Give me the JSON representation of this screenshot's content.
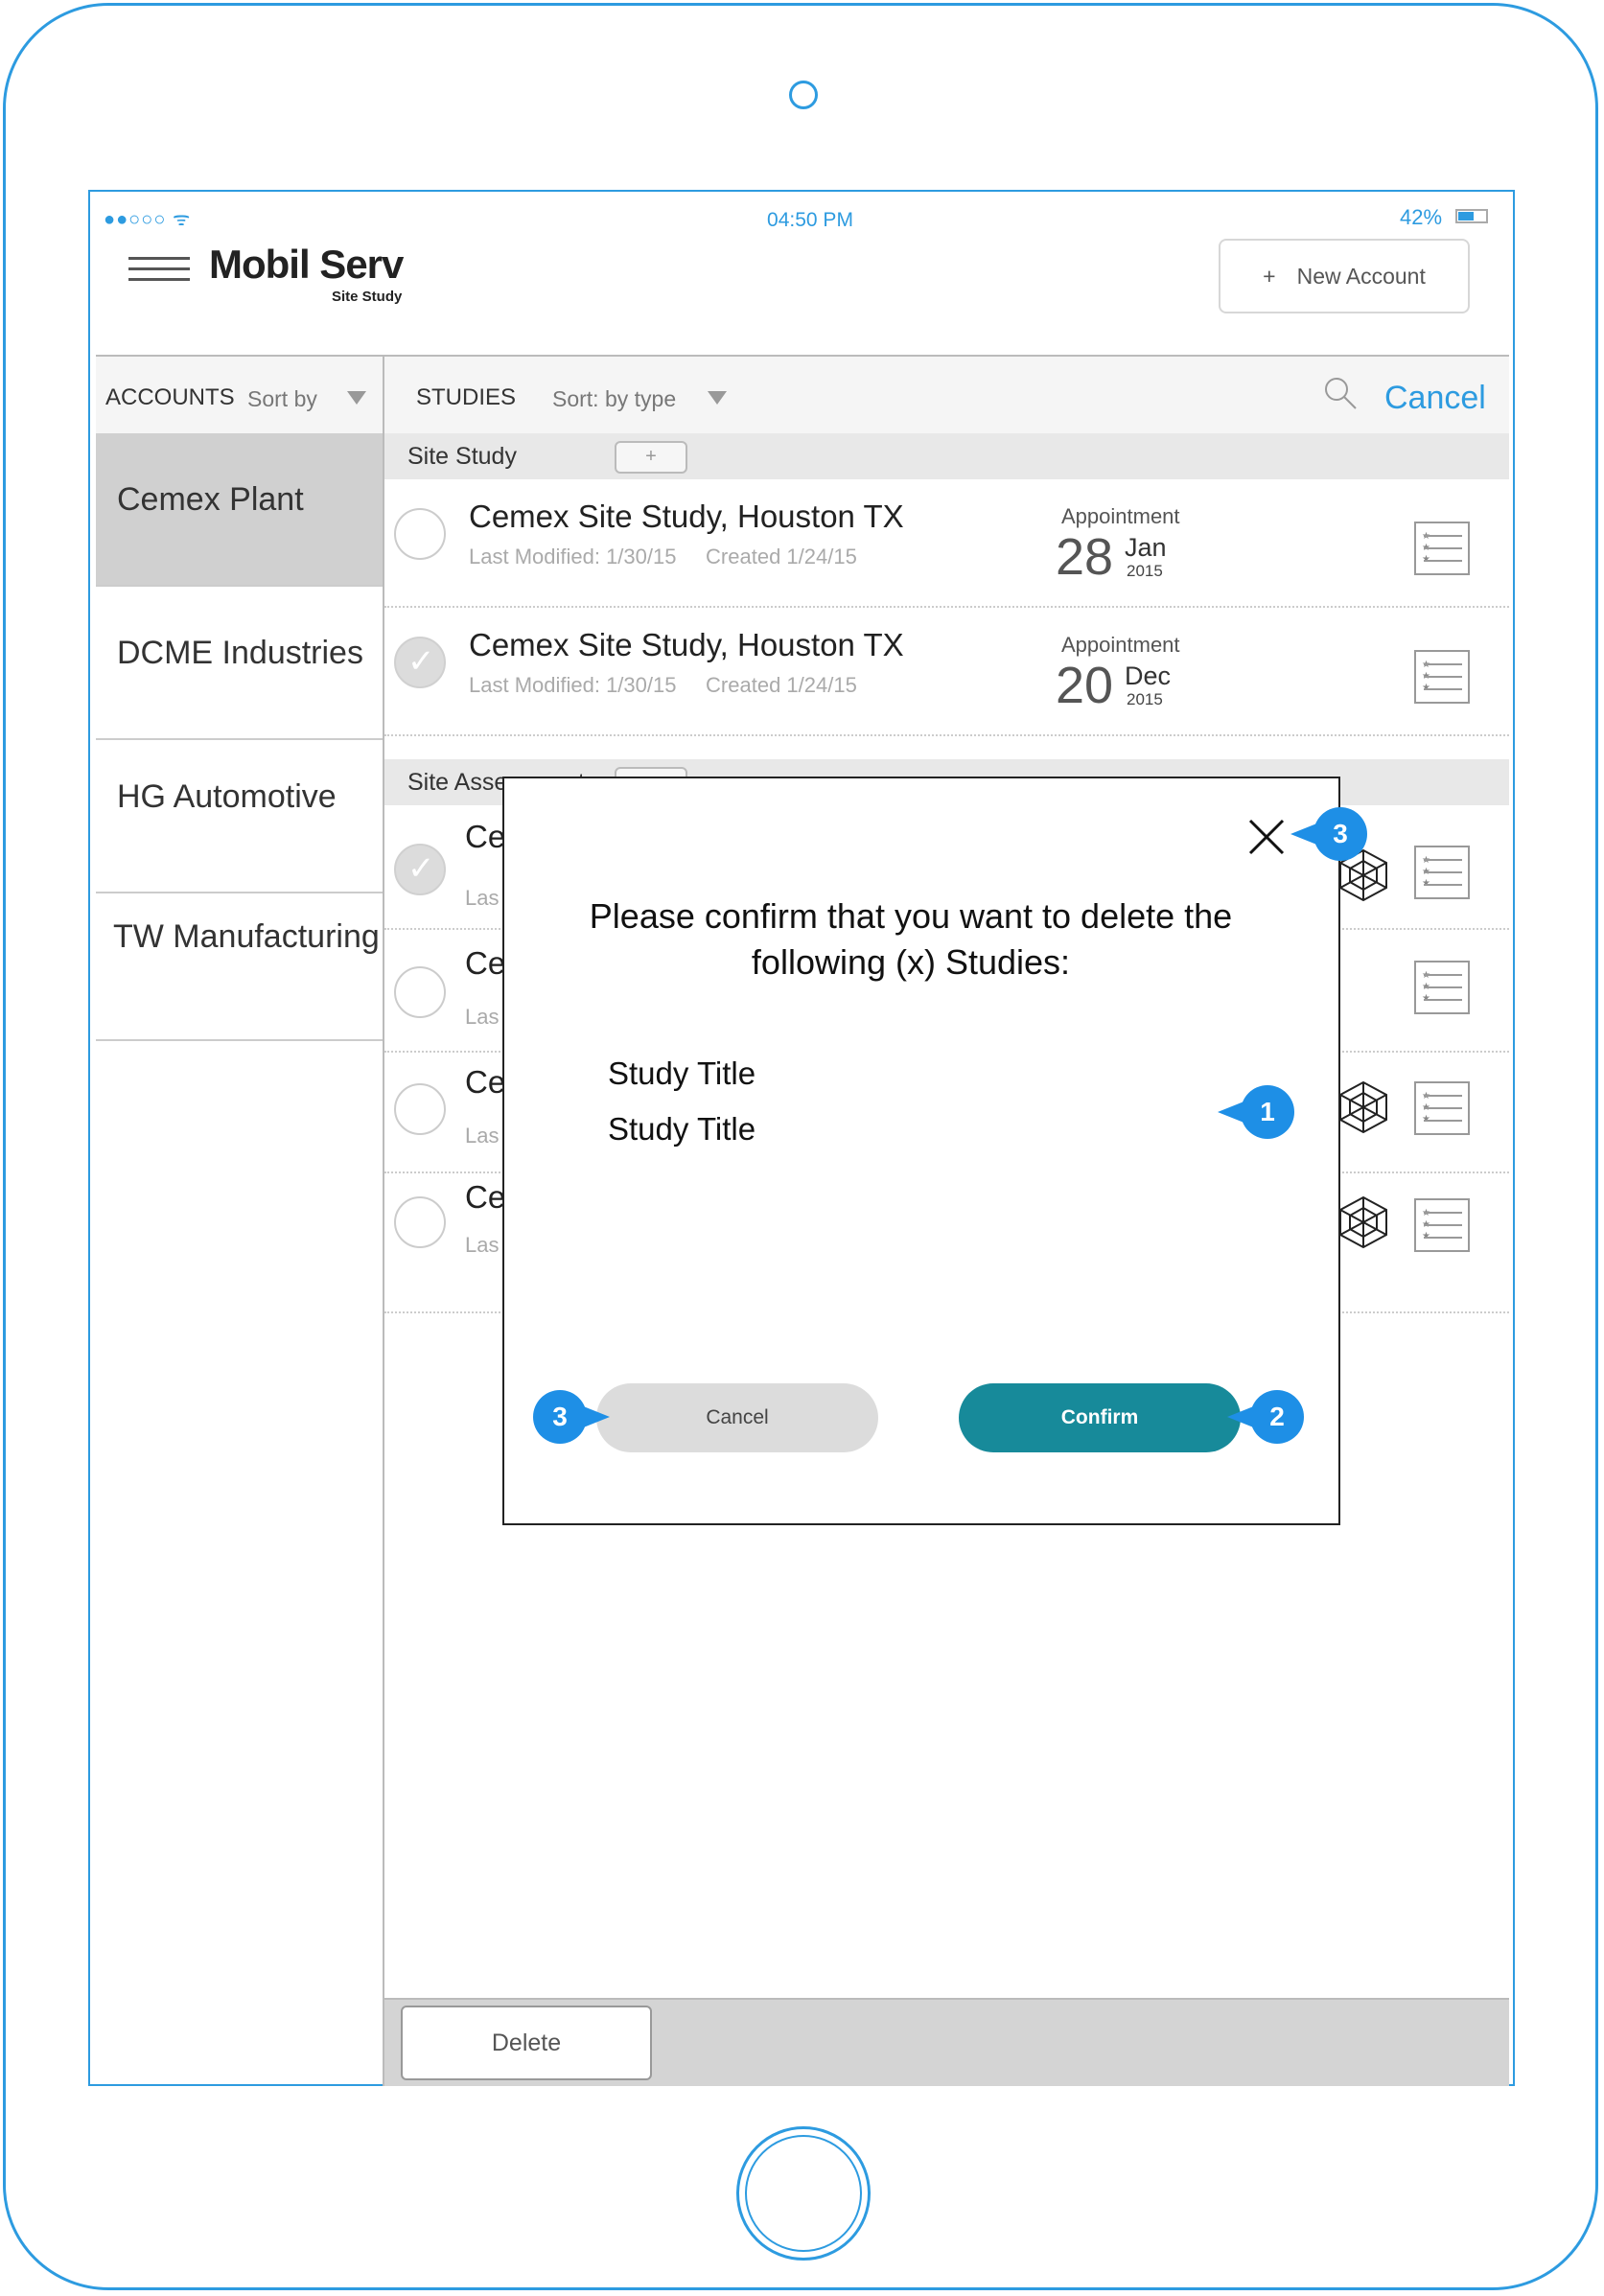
{
  "status_bar": {
    "signal": "●●○○○ ᯤ",
    "time": "04:50 PM",
    "battery": "42%"
  },
  "header": {
    "app_name": "Mobil Serv",
    "app_subtitle": "Site Study",
    "new_account_plus": "+",
    "new_account_label": "New Account"
  },
  "accounts": {
    "label": "ACCOUNTS",
    "sort_label": "Sort by",
    "items": [
      {
        "label": "Cemex Plant"
      },
      {
        "label": "DCME Industries"
      },
      {
        "label": "HG Automotive"
      },
      {
        "label": "TW Manufacturing"
      }
    ]
  },
  "studies": {
    "label": "STUDIES",
    "sort_label": "Sort: by type",
    "cancel_label": "Cancel",
    "sections": [
      {
        "title": "Site Study",
        "plus": "+"
      },
      {
        "title": "Site Assessment",
        "plus": "+"
      }
    ],
    "rows": [
      {
        "title": "Cemex Site Study, Houston TX",
        "last_modified": "Last Modified: 1/30/15",
        "created": "Created 1/24/15",
        "appt_label": "Appointment",
        "day": "28",
        "month": "Jan",
        "year": "2015"
      },
      {
        "title": "Cemex Site Study, Houston TX",
        "last_modified": "Last Modified: 1/30/15",
        "created": "Created 1/24/15",
        "appt_label": "Appointment",
        "day": "20",
        "month": "Dec",
        "year": "2015"
      },
      {
        "title": "Ce",
        "meta": "Las"
      },
      {
        "title": "Ce",
        "meta": "Las"
      },
      {
        "title": "Ce",
        "meta": "Las"
      },
      {
        "title": "Ce",
        "meta": "Las"
      }
    ]
  },
  "footer": {
    "delete_label": "Delete"
  },
  "modal": {
    "message": "Please confirm that you want to delete the following (x) Studies:",
    "items": [
      "Study Title",
      "Study Title"
    ],
    "cancel_label": "Cancel",
    "confirm_label": "Confirm"
  },
  "callouts": {
    "list": "1",
    "confirm": "2",
    "close": "3",
    "cancel": "3"
  }
}
